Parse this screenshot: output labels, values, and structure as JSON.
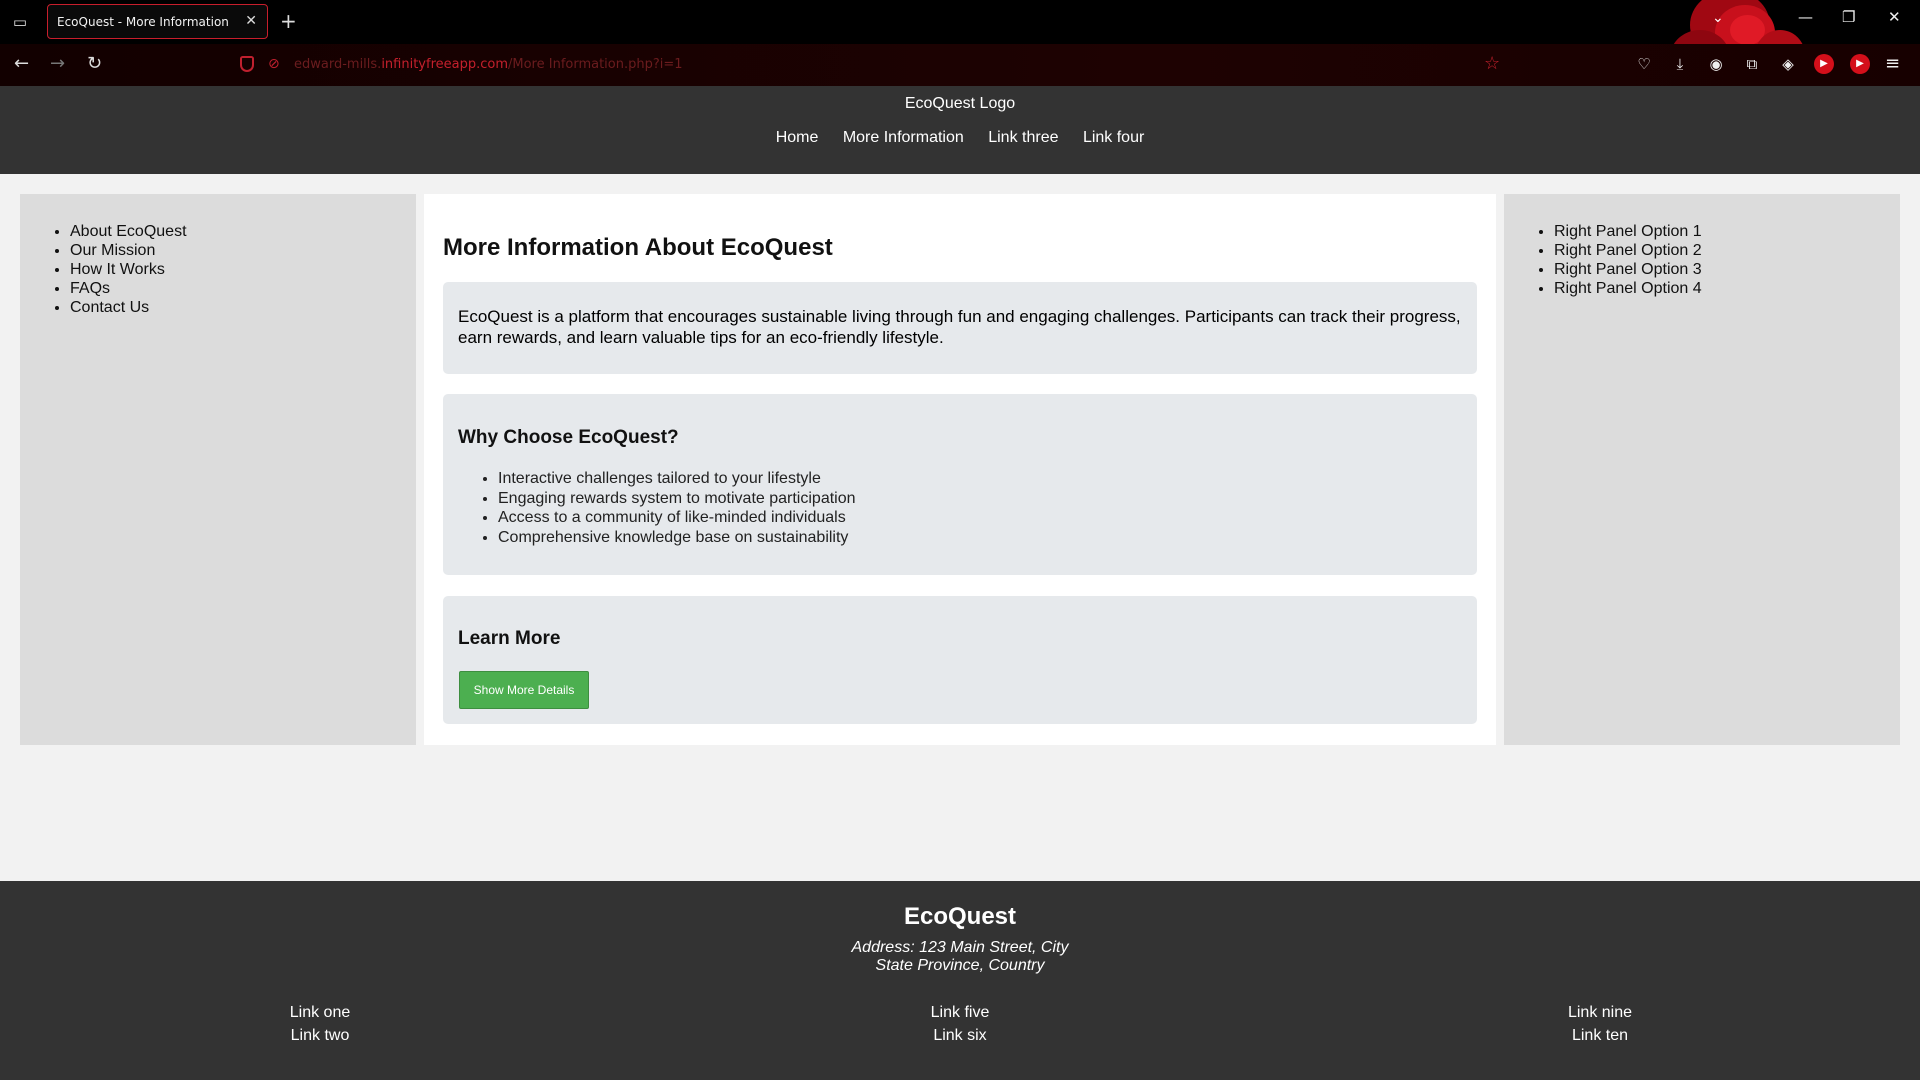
{
  "browser": {
    "tab_title": "EcoQuest - More Information",
    "tab_close": "✕",
    "new_tab": "+",
    "url_dim_prefix": "edward-mills.",
    "url_domain": "infinityfreeapp.com",
    "url_path": "/More Information.php?i=1"
  },
  "site": {
    "logo": "EcoQuest Logo",
    "nav": [
      "Home",
      "More Information",
      "Link three",
      "Link four"
    ]
  },
  "left_panel": {
    "items": [
      "About EcoQuest",
      "Our Mission",
      "How It Works",
      "FAQs",
      "Contact Us"
    ]
  },
  "right_panel": {
    "items": [
      "Right Panel Option 1",
      "Right Panel Option 2",
      "Right Panel Option 3",
      "Right Panel Option 4"
    ]
  },
  "main": {
    "title": "More Information About EcoQuest",
    "intro": "EcoQuest is a platform that encourages sustainable living through fun and engaging challenges. Participants can track their progress, earn rewards, and learn valuable tips for an eco-friendly lifestyle.",
    "why_heading": "Why Choose EcoQuest?",
    "why_items": [
      "Interactive challenges tailored to your lifestyle",
      "Engaging rewards system to motivate participation",
      "Access to a community of like-minded individuals",
      "Comprehensive knowledge base on sustainability"
    ],
    "learn_heading": "Learn More",
    "show_button": "Show More Details"
  },
  "footer": {
    "brand": "EcoQuest",
    "address_line1": "Address: 123 Main Street, City",
    "address_line2": "State Province, Country",
    "col1": [
      "Link one",
      "Link two"
    ],
    "col2": [
      "Link five",
      "Link six"
    ],
    "col3": [
      "Link nine",
      "Link ten"
    ]
  },
  "colors": {
    "accent_red": "#c4202c",
    "header_bg": "#333333",
    "button_green": "#4caf50"
  }
}
